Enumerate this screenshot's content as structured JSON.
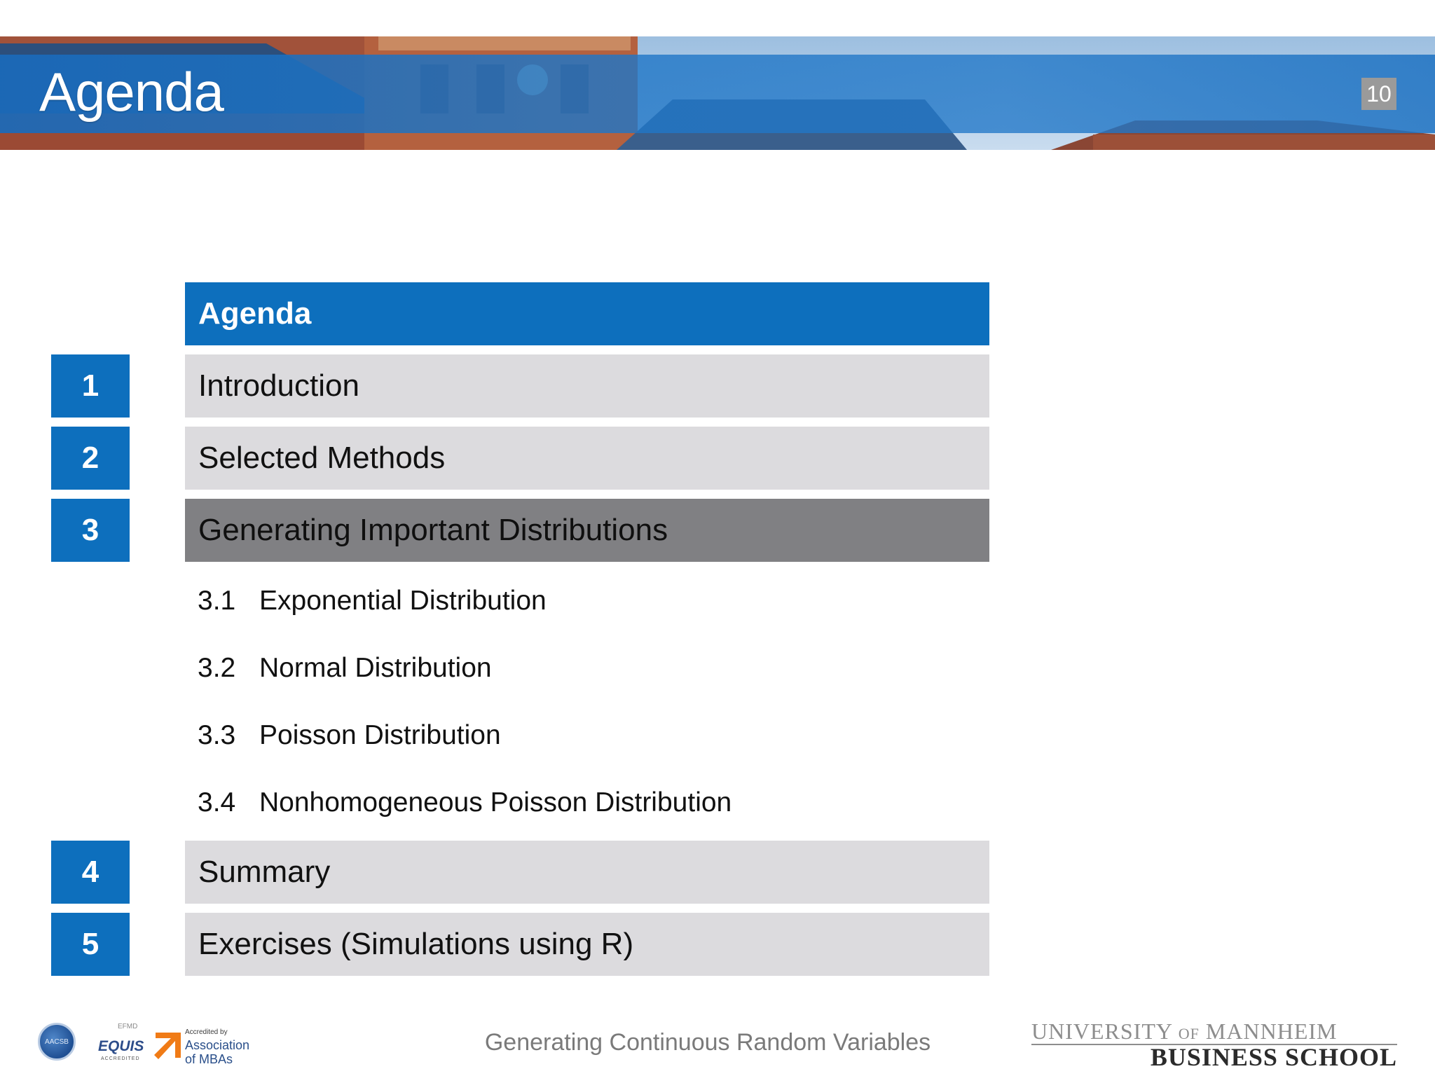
{
  "slide": {
    "title": "Agenda",
    "page_number": "10"
  },
  "agenda": {
    "header": "Agenda",
    "items": [
      {
        "number": "1",
        "label": "Introduction"
      },
      {
        "number": "2",
        "label": "Selected Methods"
      },
      {
        "number": "3",
        "label": "Generating Important Distributions"
      },
      {
        "number": "4",
        "label": "Summary"
      },
      {
        "number": "5",
        "label": "Exercises (Simulations using R)"
      }
    ],
    "active_item": "3",
    "subitems": [
      {
        "number": "3.1",
        "label": "Exponential Distribution"
      },
      {
        "number": "3.2",
        "label": "Normal Distribution"
      },
      {
        "number": "3.3",
        "label": "Poisson Distribution"
      },
      {
        "number": "3.4",
        "label": "Nonhomogeneous Poisson Distribution"
      }
    ]
  },
  "footer": {
    "center_text": "Generating Continuous Random Variables",
    "university_line1_a": "UNIVERSITY",
    "university_line1_of": "OF",
    "university_line1_b": "MANNHEIM",
    "university_line2": "BUSINESS SCHOOL",
    "accreditation": {
      "aacsb": "AACSB",
      "equis_top": "EFMD",
      "equis": "EQUIS",
      "equis_bottom": "ACCREDITED",
      "amba_small": "Accredited by",
      "amba_line1": "Association",
      "amba_line2": "of MBAs"
    }
  },
  "colors": {
    "accent_blue": "#0d6fbd",
    "row_gray": "#dcdbde",
    "row_active": "#808083"
  }
}
